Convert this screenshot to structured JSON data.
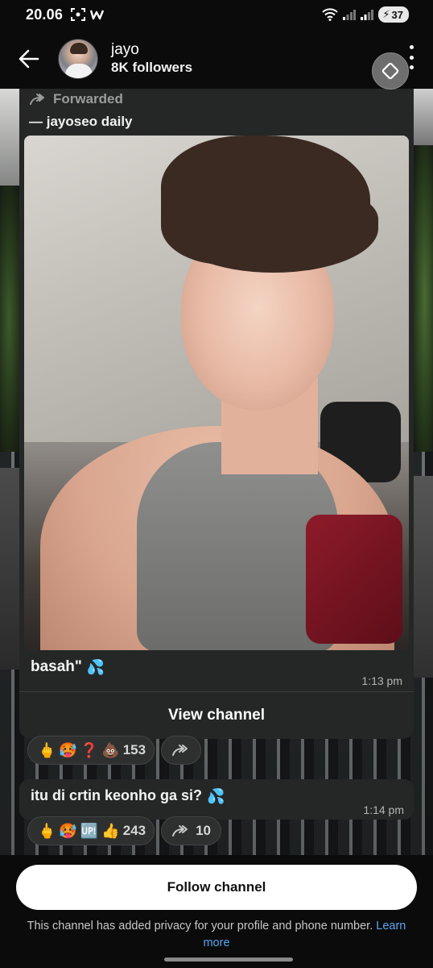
{
  "status_bar": {
    "time": "20.06",
    "battery": "37"
  },
  "header": {
    "channel_name": "jayo",
    "followers": "8K followers"
  },
  "message1": {
    "forwarded_label": "Forwarded",
    "source": "— jayoseo daily",
    "caption": "basah\"",
    "caption_emoji": "💦",
    "time": "1:13 pm",
    "view_channel_label": "View channel"
  },
  "reactions1": {
    "emojis": [
      "🖕",
      "🥵",
      "❓",
      "💩"
    ],
    "count": "153"
  },
  "message2": {
    "text": "itu di crtin keonho ga si?",
    "emoji": "💦",
    "time": "1:14 pm"
  },
  "reactions2": {
    "emojis": [
      "🖕",
      "🥵",
      "🆙",
      "👍"
    ],
    "count": "243",
    "forward_count": "10"
  },
  "bottom": {
    "follow_label": "Follow channel",
    "privacy_text": "This channel has added privacy for your profile and phone number.",
    "learn_more": "Learn more"
  }
}
